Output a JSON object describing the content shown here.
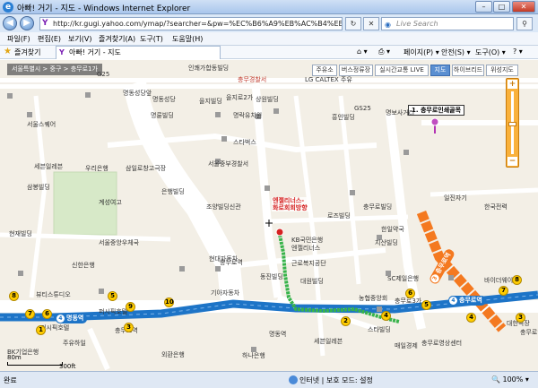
{
  "window": {
    "title": "아빠! 거기 - 지도 - Windows Internet Explorer",
    "minimize": "–",
    "maximize": "□",
    "close": "✕"
  },
  "address_bar": {
    "url": "http://kr.gugi.yahoo.com/ymap/?searcher=&pw=%EC%B6%A9%EB%AC%B4%EB%A1%9C&rid=&d",
    "search_placeholder": "Live Search",
    "back": "◀",
    "forward": "▶",
    "refresh": "↻",
    "stop": "✕",
    "go": "→"
  },
  "menu": [
    "파일(F)",
    "편집(E)",
    "보기(V)",
    "즐겨찾기(A)",
    "도구(T)",
    "도움말(H)"
  ],
  "favorites": {
    "label": "즐겨찾기",
    "tab_title": "아빠! 거기 - 지도"
  },
  "command_bar": [
    "페이지(P) ▾",
    "안전(S) ▾",
    "도구(O) ▾"
  ],
  "map": {
    "breadcrumb": "서울특별시 > 중구 > 충무로1가",
    "buttons": [
      "주유소",
      "버스정류장",
      "실시간교통 LIVE",
      "지도",
      "하이브리드",
      "위성지도"
    ],
    "active_button": "지도",
    "poi_popup": "1. 충무로인쇄골목",
    "route_popup_line1": "엔젤리너스-",
    "route_popup_line2": "화로회회방향",
    "scale_m": "80m",
    "scale_ft": "300ft",
    "labels": [
      "명동성당앞",
      "명동성당",
      "을지로2가",
      "인쾌가합동빌딩",
      "을지빌딩",
      "명보사거리",
      "충무로역",
      "충무경찰서",
      "상원빌딩",
      "LG CALTEX 주유",
      "서울스퀘어",
      "명륜빌딩",
      "명락유치원",
      "스타벅스",
      "서울중부경찰서",
      "삼일로창고극장",
      "흥인빌딩",
      "현재빌딩",
      "은행빌딩",
      "조양빌딩신관",
      "KB국민은행",
      "로즈빌딩",
      "계성여고",
      "우리은행",
      "세븐일레븐",
      "삼봉빌딩",
      "신한은행",
      "한일약국",
      "충무로빌딩",
      "지산빌딩",
      "일진자기",
      "하나은행",
      "외환은행",
      "엔젤리너스",
      "근로복지공단",
      "대원빌딩",
      "동진빌딩",
      "충무로영상센터",
      "스타빌딩",
      "바이더웨이",
      "매일경제",
      "대한극장",
      "기아자동차",
      "퍼시픽호텔",
      "SC제일은행",
      "농협중앙회",
      "서울중앙우체국",
      "현대자동차",
      "명동역",
      "충무로역",
      "G25",
      "GS25",
      "세븐일레븐",
      "퍼시픽호텔",
      "BK기업은행",
      "한국전력",
      "주유하일",
      "뷰티스튜디오",
      "충무로3가",
      "충무로인쇄골목"
    ],
    "stations": [
      {
        "num": "4",
        "name": "명동역"
      },
      {
        "num": "4",
        "name": "충무로역"
      },
      {
        "num": "3",
        "name": "충무로역"
      }
    ],
    "exits": [
      "8",
      "7",
      "6",
      "5",
      "10",
      "9",
      "3",
      "1",
      "2",
      "4",
      "6",
      "5",
      "7",
      "8",
      "4",
      "3"
    ],
    "colors": {
      "line4": "#1d74c7",
      "line3": "#f47920",
      "route": "#37b34a",
      "road": "#ffffff",
      "block": "#ece7dc",
      "school": "#d7e9c8"
    }
  },
  "status_bar": {
    "status": "완료",
    "zone": "인터넷 | 보호 모드: 설정",
    "zoom": "🔍 100% ▾"
  }
}
